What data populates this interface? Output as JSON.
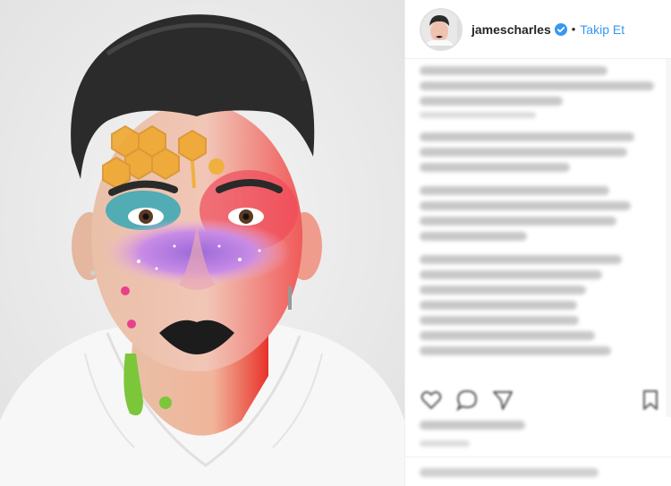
{
  "header": {
    "username": "jamescharles",
    "separator": "•",
    "follow_label": "Takip Et"
  },
  "icons": {
    "verified": "verified-badge-icon",
    "like": "heart-icon",
    "comment": "comment-icon",
    "share": "share-icon",
    "save": "bookmark-icon"
  },
  "colors": {
    "accent": "#3897f0",
    "verified": "#3897f0",
    "text": "#262626"
  }
}
